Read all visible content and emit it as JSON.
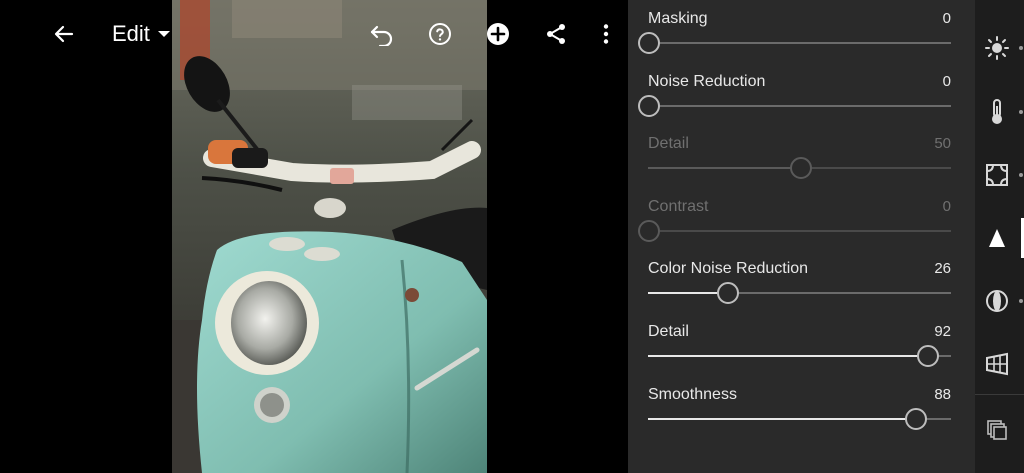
{
  "toolbar": {
    "edit_label": "Edit"
  },
  "panel": {
    "sliders": [
      {
        "label": "Masking",
        "value": "0",
        "fraction": 0.0,
        "enabled": true
      },
      {
        "label": "Noise Reduction",
        "value": "0",
        "fraction": 0.0,
        "enabled": true
      },
      {
        "label": "Detail",
        "value": "50",
        "fraction": 0.5,
        "enabled": false
      },
      {
        "label": "Contrast",
        "value": "0",
        "fraction": 0.0,
        "enabled": false
      },
      {
        "label": "Color Noise Reduction",
        "value": "26",
        "fraction": 0.26,
        "enabled": true
      },
      {
        "label": "Detail",
        "value": "92",
        "fraction": 0.92,
        "enabled": true
      },
      {
        "label": "Smoothness",
        "value": "88",
        "fraction": 0.88,
        "enabled": true
      }
    ]
  },
  "rail": {
    "tools": [
      "light-icon",
      "color-temperature-icon",
      "effects-icon",
      "detail-icon",
      "optics-icon",
      "geometry-icon",
      "presets-icon"
    ],
    "active_tool": "detail-icon"
  },
  "colors": {
    "panel_bg": "#2a2a2a",
    "rail_bg": "#1d1d1d",
    "scooter_mint": "#86c7b7"
  }
}
